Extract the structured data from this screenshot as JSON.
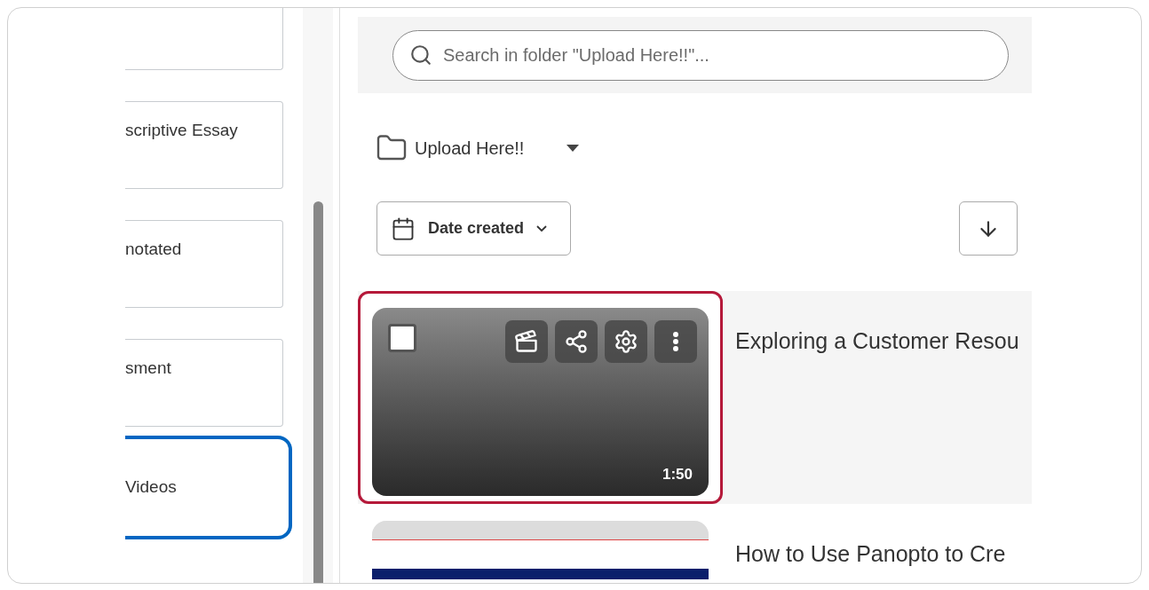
{
  "sidebar": {
    "items": [
      {
        "selected": false
      },
      {
        "label": "scriptive Essay",
        "selected": false
      },
      {
        "label": "notated",
        "selected": false
      },
      {
        "label": "sment",
        "selected": false
      },
      {
        "label": "Videos",
        "selected": true
      }
    ]
  },
  "search": {
    "placeholder": "Search in folder \"Upload Here!!\"..."
  },
  "folder": {
    "name": "Upload Here!!"
  },
  "sort": {
    "label": "Date created"
  },
  "videos": [
    {
      "title": "Exploring a Customer Resou",
      "duration": "1:50",
      "checked": false,
      "selected": true,
      "kind": "dark"
    },
    {
      "title": "How to Use Panopto to Cre",
      "selected": false,
      "kind": "light"
    }
  ]
}
